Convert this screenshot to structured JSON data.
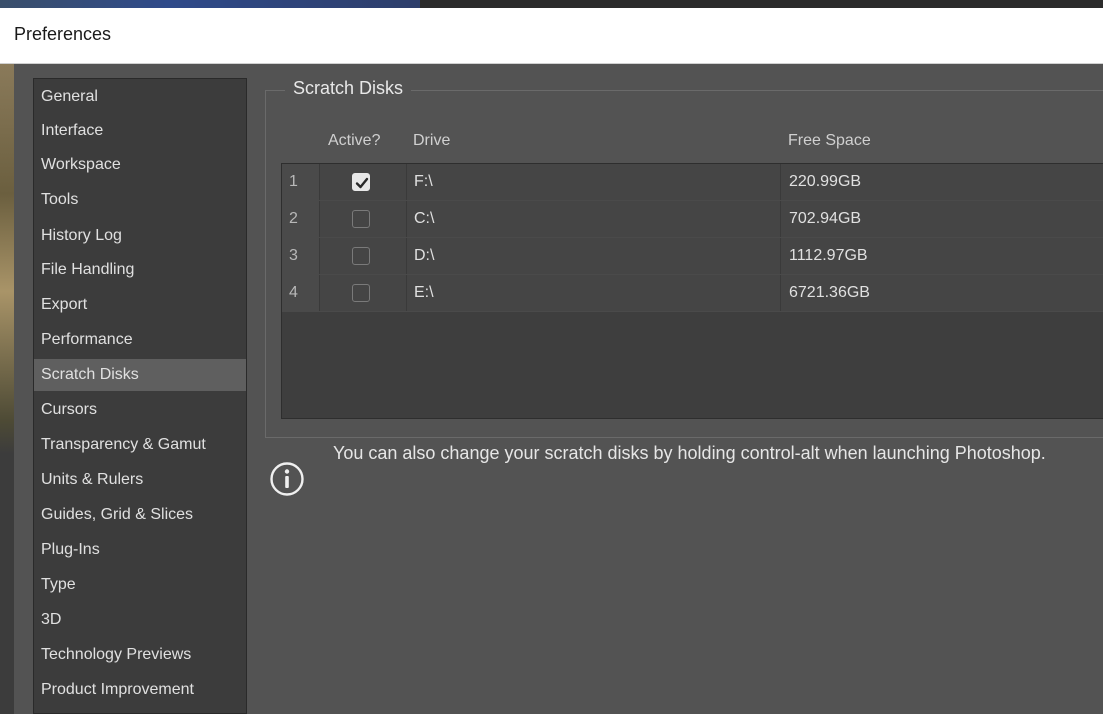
{
  "window": {
    "title": "Preferences"
  },
  "sidebar": {
    "selected": "Scratch Disks",
    "items": [
      {
        "label": "General"
      },
      {
        "label": "Interface"
      },
      {
        "label": "Workspace"
      },
      {
        "label": "Tools"
      },
      {
        "label": "History Log"
      },
      {
        "label": "File Handling"
      },
      {
        "label": "Export"
      },
      {
        "label": "Performance"
      },
      {
        "label": "Scratch Disks"
      },
      {
        "label": "Cursors"
      },
      {
        "label": "Transparency & Gamut"
      },
      {
        "label": "Units & Rulers"
      },
      {
        "label": "Guides, Grid & Slices"
      },
      {
        "label": "Plug-Ins"
      },
      {
        "label": "Type"
      },
      {
        "label": "3D"
      },
      {
        "label": "Technology Previews"
      },
      {
        "label": "Product Improvement"
      }
    ]
  },
  "scratch_disks": {
    "group_title": "Scratch Disks",
    "columns": {
      "active": "Active?",
      "drive": "Drive",
      "free_space": "Free Space"
    },
    "rows": [
      {
        "index": "1",
        "active": true,
        "drive": "F:\\",
        "free_space": "220.99GB"
      },
      {
        "index": "2",
        "active": false,
        "drive": "C:\\",
        "free_space": "702.94GB"
      },
      {
        "index": "3",
        "active": false,
        "drive": "D:\\",
        "free_space": "1112.97GB"
      },
      {
        "index": "4",
        "active": false,
        "drive": "E:\\",
        "free_space": "6721.36GB"
      }
    ]
  },
  "info": {
    "icon": "info-circle-icon",
    "text": "You can also change your scratch disks by holding control-alt when launching Photoshop."
  },
  "colors": {
    "panel_bg": "#535353",
    "sidebar_bg": "#3c3c3c",
    "selected_bg": "#5f5f5f",
    "table_bg": "#3e3e3e"
  }
}
